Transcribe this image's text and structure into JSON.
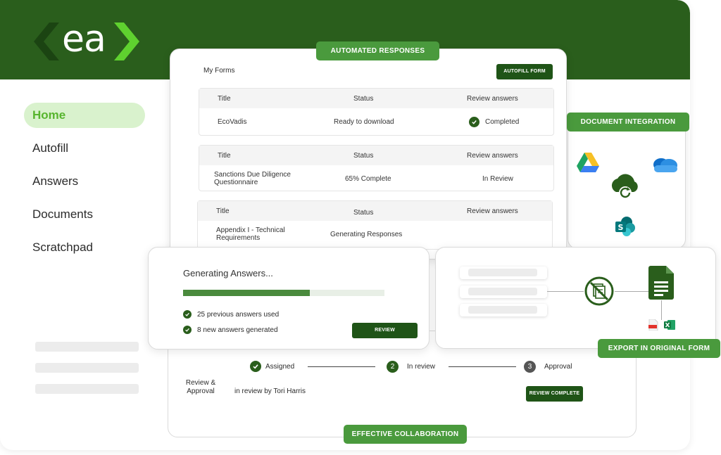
{
  "logo": {
    "text": "ea"
  },
  "sidebar": {
    "items": [
      {
        "label": "Home",
        "active": true
      },
      {
        "label": "Autofill"
      },
      {
        "label": "Answers"
      },
      {
        "label": "Documents"
      },
      {
        "label": "Scratchpad"
      }
    ]
  },
  "badges": {
    "automated": "AUTOMATED RESPONSES",
    "integration": "DOCUMENT INTEGRATION",
    "export": "EXPORT IN ORIGINAL FORM",
    "collaboration": "EFFECTIVE COLLABORATION"
  },
  "forms": {
    "title": "My Forms",
    "autofill_button": "AUTOFILL FORM",
    "tables": [
      {
        "headers": [
          "Title",
          "Status",
          "Review answers"
        ],
        "title": "EcoVadis",
        "status": "Ready to download",
        "review": "Completed"
      },
      {
        "headers": [
          "Title",
          "Status",
          "Review answers"
        ],
        "title": "Sanctions Due Diligence Questionnaire",
        "status": "65% Complete",
        "review": "In Review"
      },
      {
        "headers": [
          "Title",
          "Status",
          "Review answers"
        ],
        "title": "Appendix I - Technical Requirements",
        "status": "Generating Responses",
        "review": ""
      }
    ]
  },
  "generating": {
    "title": "Generating Answers...",
    "progress": 0.63,
    "items": [
      "25 previous answers used",
      "8 new answers generated"
    ],
    "review_button": "REVIEW"
  },
  "workflow": {
    "steps": [
      {
        "label": "Assigned"
      },
      {
        "number": "2",
        "label": "In review"
      },
      {
        "number": "3",
        "label": "Approval"
      }
    ],
    "section_label": "Review & Approval",
    "status_text": "in review by Tori Harris",
    "complete_button": "REVIEW COMPLETE"
  },
  "colors": {
    "brand_dark": "#2a5e1c",
    "brand_green": "#4a9a3d",
    "accent_light": "#d9f2cd",
    "accent_text": "#57b52e"
  }
}
